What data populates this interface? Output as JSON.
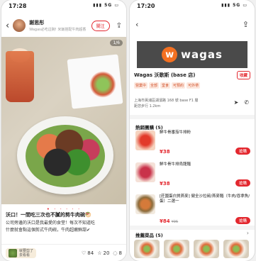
{
  "phone1": {
    "status": {
      "time": "17:28",
      "signal": "5G"
    },
    "user": {
      "name": "謝思彤",
      "desc": "Wagas必吃這碗! 米飯搭配牛肉超香"
    },
    "follow_label": "關注",
    "photo_counter": "1/6",
    "title": "沃口！一間吃三次也不膩的剪牛肉碗🥙",
    "body": [
      "公司旁邊的沃口是我最愛的食堂！每次不知道吃",
      "什麼就會點這個剪式牛肉碗，牛肉超嫩鮮甜✔"
    ],
    "tag_label": [
      "就要剪了",
      "去看看"
    ],
    "counts": {
      "likes": "84",
      "stars": "20",
      "comments": "8"
    }
  },
  "phone2": {
    "status": {
      "time": "17:20",
      "signal": "5G"
    },
    "brand": {
      "logo_letter": "w",
      "name": "wagas"
    },
    "shop": {
      "name": "Wagas 沃歌斯 (base 店)",
      "fav_label": "收藏",
      "chips": [
        "營業中",
        "全部",
        "堂食",
        "可預約",
        "可外帶"
      ]
    },
    "address": [
      "上海市黃浦區湖濱路 168 號 base F1 層",
      "距您步行 1.2km"
    ],
    "section_title": "熱銷團購 (5)",
    "products": [
      {
        "name": "鮮牛骨番茄牛排粉",
        "price": "¥38",
        "orig": "",
        "buy": "搶購"
      },
      {
        "name": "鮮牛骨牛排烏龍麵",
        "price": "¥38",
        "orig": "",
        "buy": "搶購"
      },
      {
        "name": "[莊園蛋白質燕麥] 健全沙拉碗/燕麥麵（牛肉/吞拿魚/蛋）二選一",
        "price": "¥84",
        "orig": "¥95",
        "buy": "搶購"
      }
    ],
    "recs_title": "推薦菜品 (5)"
  }
}
